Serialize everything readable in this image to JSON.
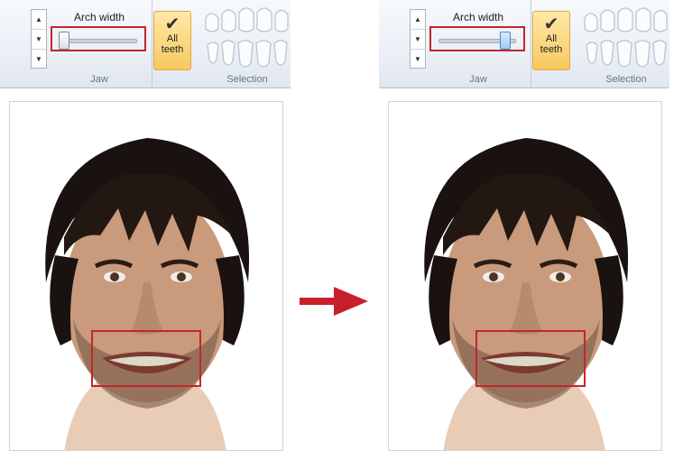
{
  "panels": [
    {
      "arch_width_label": "Arch width",
      "arch_width_value": 0.05,
      "all_teeth_label_1": "All",
      "all_teeth_label_2": "teeth",
      "jaw_group_label": "Jaw",
      "selection_group_label": "Selection"
    },
    {
      "arch_width_label": "Arch width",
      "arch_width_value": 0.85,
      "all_teeth_label_1": "All",
      "all_teeth_label_2": "teeth",
      "jaw_group_label": "Jaw",
      "selection_group_label": "Selection"
    }
  ],
  "colors": {
    "highlight_red": "#c0272d",
    "arrow_red": "#c8202a",
    "button_gold": "#f7c95f"
  },
  "icons": {
    "stepper_up": "triangle-up-icon",
    "stepper_down": "triangle-down-icon",
    "stepper_more": "more-arrow-icon",
    "check": "checkmark-icon",
    "arrow": "right-arrow-icon"
  }
}
